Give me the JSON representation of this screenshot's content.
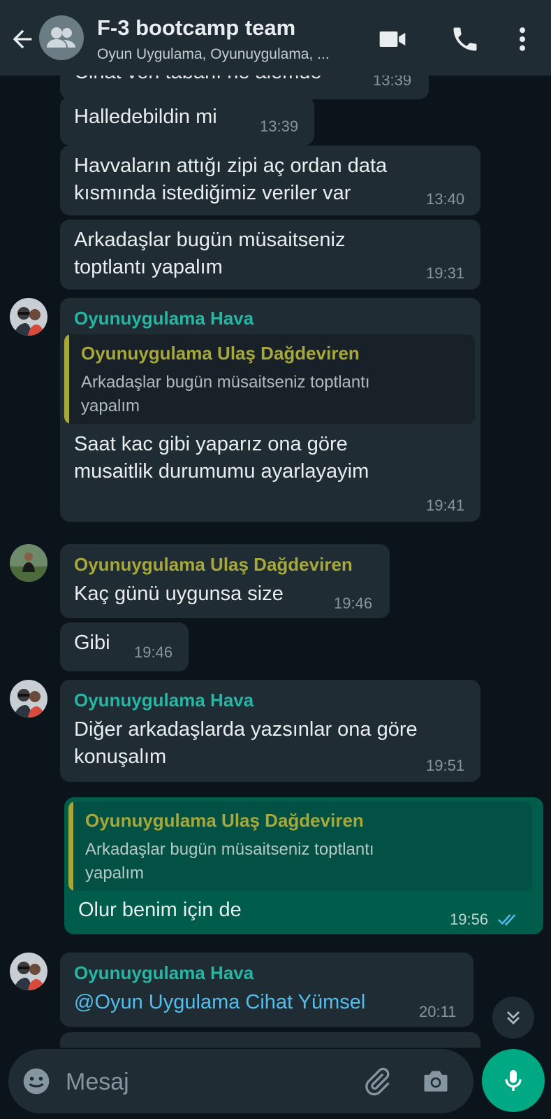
{
  "header": {
    "title": "F-3 bootcamp team",
    "subtitle": "Oyun Uygulama, Oyunuygulama, ...",
    "back_icon": "back-arrow-icon",
    "avatar_icon": "group-avatar-icon",
    "actions": [
      "video-call-icon",
      "voice-call-icon",
      "more-options-icon"
    ]
  },
  "colors": {
    "header_bg": "#1f2c34",
    "chat_bg": "#0b141a",
    "incoming_bubble": "#1f2c34",
    "outgoing_bubble": "#005c4b",
    "sender_hava": "#25b7a3",
    "sender_ulas": "#a8a839",
    "mention": "#53bdeb",
    "accent": "#00a884"
  },
  "messages": [
    {
      "text": "Cihat veri tabanı ne alemde",
      "time": "13:39"
    },
    {
      "text": "Halledebildin mi",
      "time": "13:39"
    },
    {
      "text": "Havvaların attığı zipi aç ordan data\nkısmında istediğimiz veriler var",
      "time": "13:40"
    },
    {
      "text": "Arkadaşlar bugün müsaitseniz\ntoptlantı yapalım",
      "time": "19:31"
    },
    {
      "sender": "Oyunuygulama Hava",
      "quote": {
        "name": "Oyunuygulama Ulaş Dağdeviren",
        "text": "Arkadaşlar bugün müsaitseniz toptlantı\nyapalım"
      },
      "text": "Saat kac gibi yaparız ona göre\nmusaitlik durumumu ayarlayayim",
      "time": "19:41"
    },
    {
      "sender": "Oyunuygulama Ulaş Dağdeviren",
      "text": "Kaç günü uygunsa size",
      "time": "19:46"
    },
    {
      "text": "Gibi",
      "time": "19:46"
    },
    {
      "sender": "Oyunuygulama Hava",
      "text": "Diğer arkadaşlarda yazsınlar ona göre\nkonuşalım",
      "time": "19:51"
    },
    {
      "outgoing": true,
      "quote": {
        "name": "Oyunuygulama Ulaş Dağdeviren",
        "text": "Arkadaşlar bugün müsaitseniz toptlantı\nyapalım"
      },
      "text": "Olur benim için de",
      "time": "19:56",
      "status_icon": "double-check-read-icon"
    },
    {
      "sender": "Oyunuygulama Hava",
      "text": "@Oyun Uygulama Cihat Yümsel",
      "time": "20:11"
    }
  ],
  "composer": {
    "placeholder": "Mesaj",
    "icons": [
      "emoji-icon",
      "attach-icon",
      "camera-icon",
      "mic-icon"
    ]
  },
  "scroll_down_icon": "chevron-double-down-icon"
}
